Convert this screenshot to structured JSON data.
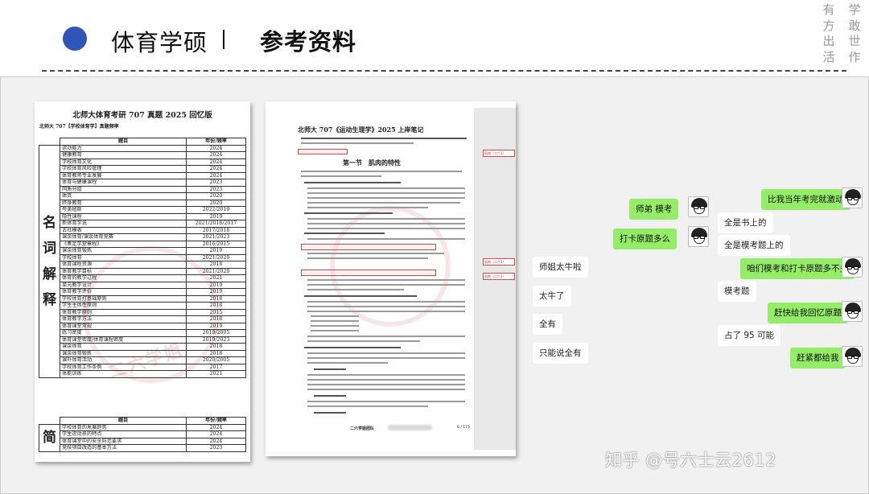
{
  "header": {
    "title": "体育学硕",
    "separator": "|",
    "subtitle": "参考资料",
    "seal_chars": [
      "有",
      "学",
      "方",
      "敢",
      "出",
      "世",
      "活",
      "作"
    ]
  },
  "doc1": {
    "title": "北师大体育考研 707 真题 2025 回忆版",
    "subtitle": "北师大 707【学校体育学】真题频率",
    "col_term": "题目",
    "col_year": "年份/频率",
    "section1_label": [
      "名",
      "词",
      "解",
      "释"
    ],
    "section1_rows": [
      [
        "运动能力",
        "2024"
      ],
      [
        "健康教育",
        "2024"
      ],
      [
        "学校体育文化",
        "2024"
      ],
      [
        "学校体育风险管理",
        "2024"
      ],
      [
        "体育教师专业发展",
        "2024"
      ],
      [
        "体育与健康课程",
        "2023"
      ],
      [
        "同质分组",
        "2023"
      ],
      [
        "体質",
        "2020"
      ],
      [
        "终身教育",
        "2020"
      ],
      [
        "夸美纽斯",
        "2022/2019"
      ],
      [
        "隐性课程",
        "2019"
      ],
      [
        "新体育学说",
        "2021/2018/2017"
      ],
      [
        "古社模表",
        "2017/2018"
      ],
      [
        "课余体育/课余体育竞赛",
        "2021/2023"
      ],
      [
        "《奏定学堂章程》",
        "2016/2015"
      ],
      [
        "课余体育锻炼",
        "2019"
      ],
      [
        "学校体育",
        "2021/2020"
      ],
      [
        "体育课程资源",
        "2018"
      ],
      [
        "体育教学目标",
        "2021/2020"
      ],
      [
        "体育的教学过程",
        "2021"
      ],
      [
        "单元教学设计",
        "2019"
      ],
      [
        "体育教学评价",
        "2019"
      ],
      [
        "学校体育打基础原则",
        "2018"
      ],
      [
        "学生主体性原则",
        "2018"
      ],
      [
        "体育教学原则",
        "2015"
      ],
      [
        "体育教学方法",
        "2018"
      ],
      [
        "体育课堂常规",
        "2019"
      ],
      [
        "练习密度",
        "2019/2005"
      ],
      [
        "体育课堂密度/体育课程密度",
        "2019/2023"
      ],
      [
        "课余体育",
        "2018"
      ],
      [
        "课余体育锻炼",
        "2018"
      ],
      [
        "课外体育活动",
        "2020/2005"
      ],
      [
        "学校体育工作条例",
        "2017"
      ],
      [
        "体能训练",
        "2021"
      ]
    ],
    "section2_label": "简",
    "section2_rows": [
      [
        "学校体育的发展趋势",
        "2024"
      ],
      [
        "学生运动员的特点",
        "2024"
      ],
      [
        "体育课堂中的安全防范要求",
        "2024"
      ],
      [
        "竞技项目改造的基本方法",
        "2023"
      ]
    ],
    "watermark": "二六学姐"
  },
  "doc2": {
    "title": "北师大 707《运动生理学》2025 上岸笔记",
    "section_heading": "第一节　肌肉的特性",
    "notes": [
      "肌肉（二六1）",
      "肌肉（二六1）",
      "肌肉（二六1）"
    ],
    "footer": "二六学姐团队",
    "page": "6 / 175"
  },
  "chat_left": {
    "messages": [
      {
        "text": "师弟 模考",
        "style": "green"
      },
      {
        "text": "打卡原题多么",
        "style": "green"
      },
      {
        "text": "师姐太牛啦",
        "style": "white"
      },
      {
        "text": "太牛了",
        "style": "white"
      },
      {
        "text": "全有",
        "style": "white"
      },
      {
        "text": "只能说全有",
        "style": "white"
      }
    ]
  },
  "chat_right": {
    "messages": [
      {
        "text": "比我当年考完就激动",
        "style": "green"
      },
      {
        "text": "全是书上的",
        "style": "white"
      },
      {
        "text": "全是模考题上的",
        "style": "white"
      },
      {
        "text": "咱们模考和打卡原题多不多",
        "style": "green"
      },
      {
        "text": "模考题",
        "style": "white"
      },
      {
        "text": "赶快给我回忆原题",
        "style": "green"
      },
      {
        "text": "占了 95 可能",
        "style": "white"
      },
      {
        "text": "赶紧都给我",
        "style": "green"
      }
    ]
  },
  "watermark_zhihu": "知乎 @号六士云2612",
  "colors": {
    "accent_dot": "#2f55b8",
    "bubble_green": "#95ec69",
    "panel_bg": "#f1f1f1"
  }
}
